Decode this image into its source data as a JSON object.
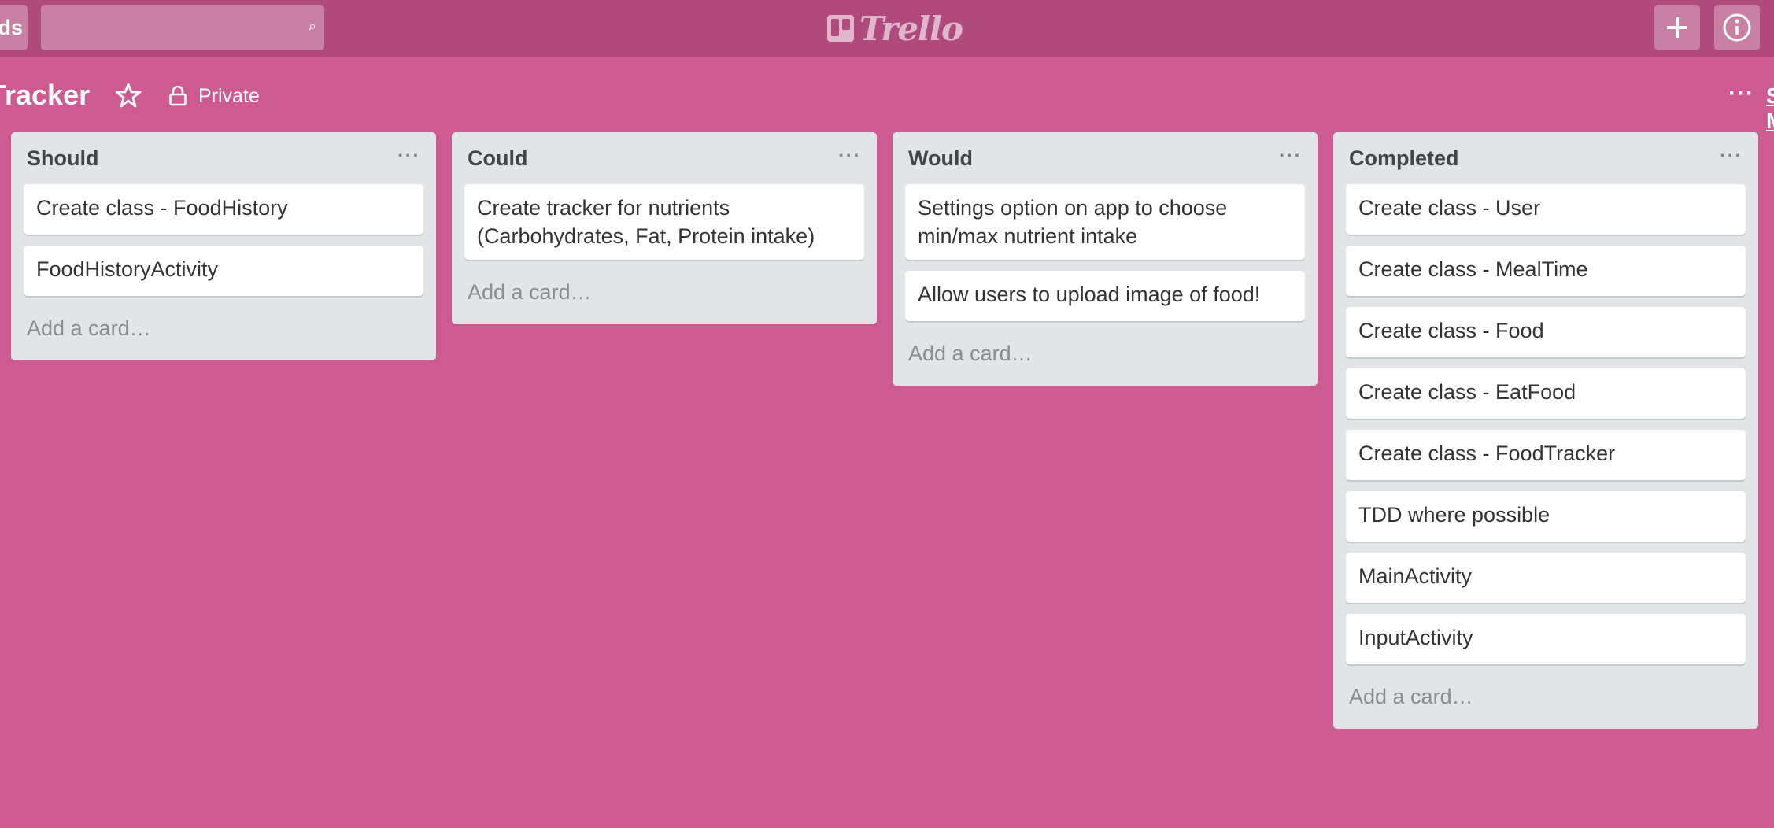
{
  "app": {
    "logo_text": "Trello"
  },
  "topbar": {
    "boards_label": "Boards",
    "search": {
      "value": "",
      "placeholder": ""
    },
    "add_icon": "plus-icon",
    "info_icon": "info-icon"
  },
  "board": {
    "title": "Tracker",
    "visibility": "Private",
    "show_menu": "Show Menu",
    "menu_dots": "···"
  },
  "colors": {
    "background": "#cd5a91",
    "topbar": "#b04a7b",
    "list": "#e2e4e6"
  },
  "lists": [
    {
      "title": "Should",
      "menu": "···",
      "cards": [
        "Create class - FoodHistory",
        "FoodHistoryActivity"
      ],
      "add_card": "Add a card…"
    },
    {
      "title": "Could",
      "menu": "···",
      "cards": [
        "Create tracker for nutrients (Carbohydrates, Fat, Protein intake)"
      ],
      "add_card": "Add a card…"
    },
    {
      "title": "Would",
      "menu": "···",
      "cards": [
        "Settings option on app to choose min/max nutrient intake",
        "Allow users to upload image of food!"
      ],
      "add_card": "Add a card…"
    },
    {
      "title": "Completed",
      "menu": "···",
      "cards": [
        "Create class - User",
        "Create class - MealTime",
        "Create class - Food",
        "Create class - EatFood",
        "Create class - FoodTracker",
        "TDD where possible",
        "MainActivity",
        "InputActivity"
      ],
      "add_card": "Add a card…"
    }
  ]
}
